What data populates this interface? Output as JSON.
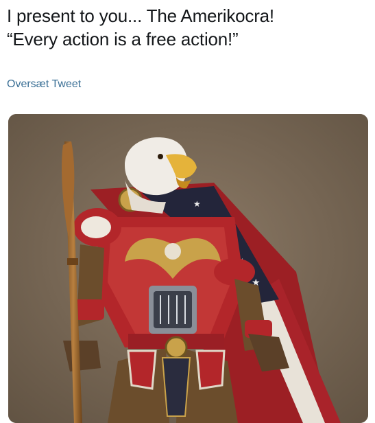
{
  "tweet": {
    "text_line_1": "I present to you... The Amerikocra!",
    "text_line_2": "“Every action is a free action!”",
    "translate_label": "Oversæt Tweet"
  },
  "media": {
    "alt": "Figurine of an armored bald eagle warrior wearing an American flag cape and holding a wooden spear"
  },
  "colors": {
    "link": "#3a6f95",
    "text": "#14171a",
    "armor_red": "#b3262a",
    "flag_blue": "#2a2c3e",
    "gold": "#c9a24a",
    "backdrop": "#7d6c5a"
  }
}
